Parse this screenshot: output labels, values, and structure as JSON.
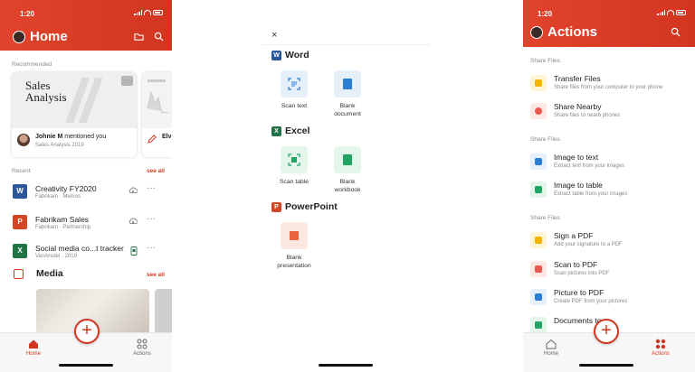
{
  "colors": {
    "accent": "#d23620",
    "word": "#2b579a",
    "excel": "#217346",
    "powerpoint": "#d24726",
    "pdf": "#e85a4f",
    "yellow": "#f4b400"
  },
  "home": {
    "time": "1:20",
    "title": "Home",
    "recommended_label": "Recommended",
    "card1": {
      "doc_title": "Sales Analysis",
      "person": "Johnie M",
      "action": "mentioned you",
      "sub": "Sales Analysis 2019"
    },
    "card2": {
      "person_short": "Elv"
    },
    "recent_label": "Recent",
    "see_all": "see all",
    "recent": [
      {
        "name": "Creativity FY2020",
        "sub": "Fabrikam · Memos",
        "app": "W"
      },
      {
        "name": "Fabrikam Sales",
        "sub": "Fabrikam · Partnership",
        "app": "P"
      },
      {
        "name": "Social media co...t tracker",
        "sub": "VanArsdel · 2019",
        "app": "X"
      }
    ],
    "media_title": "Media",
    "media_see_all": "see all",
    "nav": {
      "home": "Home",
      "actions": "Actions"
    }
  },
  "create": {
    "close": "×",
    "word": {
      "label": "Word",
      "tiles": [
        "Scan text",
        "Blank document"
      ]
    },
    "excel": {
      "label": "Excel",
      "tiles": [
        "Scan table",
        "Blank workbook"
      ]
    },
    "powerpoint": {
      "label": "PowerPoint",
      "tiles": [
        "Blank presentation"
      ]
    }
  },
  "actions": {
    "time": "1:20",
    "title": "Actions",
    "groups": [
      {
        "label": "Share Files",
        "items": [
          {
            "title": "Transfer Files",
            "sub": "Share files from your computer to your phone"
          },
          {
            "title": "Share Nearby",
            "sub": "Share files to nearb phones"
          }
        ]
      },
      {
        "label": "Share Files",
        "items": [
          {
            "title": "Image to text",
            "sub": "Extract text from your images"
          },
          {
            "title": "Image to table",
            "sub": "Extract table from your images"
          }
        ]
      },
      {
        "label": "Share Files",
        "items": [
          {
            "title": "Sign a PDF",
            "sub": "Add your signature to a PDF"
          },
          {
            "title": "Scan to PDF",
            "sub": "Scan pictures into PDF"
          },
          {
            "title": "Picture to PDF",
            "sub": "Create PDF from your pictures"
          },
          {
            "title": "Documents to",
            "sub": ""
          }
        ]
      }
    ],
    "nav": {
      "home": "Home",
      "actions": "Actions"
    }
  }
}
